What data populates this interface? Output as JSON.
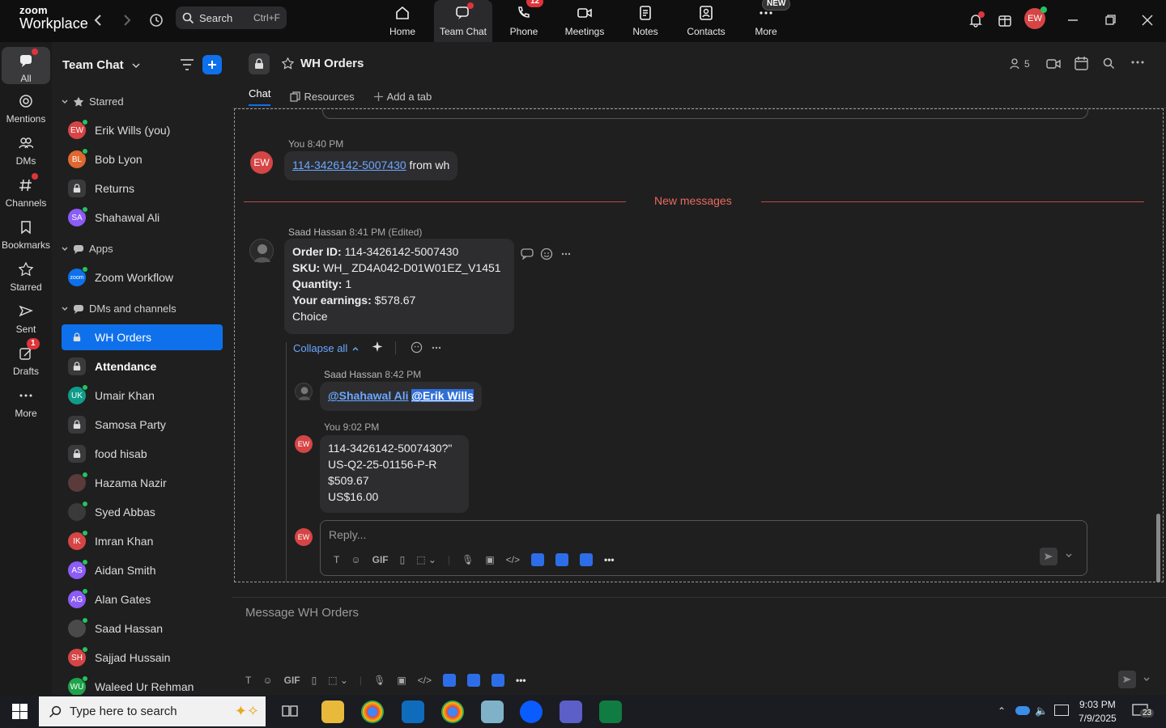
{
  "app": {
    "logo_line1": "zoom",
    "logo_line2": "Workplace"
  },
  "topbar": {
    "search_label": "Search",
    "search_shortcut": "Ctrl+F",
    "nav": [
      {
        "label": "Home"
      },
      {
        "label": "Team Chat"
      },
      {
        "label": "Phone",
        "badge": "12"
      },
      {
        "label": "Meetings"
      },
      {
        "label": "Notes"
      },
      {
        "label": "Contacts"
      },
      {
        "label": "More",
        "badge": "NEW"
      }
    ],
    "avatar_initials": "EW"
  },
  "rail": [
    {
      "label": "All"
    },
    {
      "label": "Mentions"
    },
    {
      "label": "DMs"
    },
    {
      "label": "Channels"
    },
    {
      "label": "Bookmarks"
    },
    {
      "label": "Starred"
    },
    {
      "label": "Sent"
    },
    {
      "label": "Drafts",
      "badge": "1"
    },
    {
      "label": "More"
    }
  ],
  "sidebar": {
    "title": "Team Chat",
    "sections": {
      "starred": "Starred",
      "apps": "Apps",
      "dms": "DMs and channels"
    },
    "starred": [
      {
        "initials": "EW",
        "name": "Erik Wills (you)",
        "color": "#d64545"
      },
      {
        "initials": "BL",
        "name": "Bob Lyon",
        "color": "#e0672f"
      },
      {
        "initials": "",
        "name": "Returns",
        "color": "lock"
      },
      {
        "initials": "SA",
        "name": "Shahawal Ali",
        "color": "#8b5cf6"
      }
    ],
    "apps": [
      {
        "initials": "zoom",
        "name": "Zoom Workflow",
        "color": "#0e71eb"
      }
    ],
    "dms": [
      {
        "initials": "",
        "name": "WH Orders",
        "color": "lock"
      },
      {
        "initials": "",
        "name": "Attendance",
        "color": "lock"
      },
      {
        "initials": "UK",
        "name": "Umair Khan",
        "color": "#0f9d8a"
      },
      {
        "initials": "",
        "name": "Samosa Party",
        "color": "lock"
      },
      {
        "initials": "",
        "name": "food hisab",
        "color": "lock"
      },
      {
        "initials": "",
        "name": "Hazama Nazir",
        "color": "#5a3a3a"
      },
      {
        "initials": "",
        "name": "Syed Abbas",
        "color": "#3a3a3a"
      },
      {
        "initials": "IK",
        "name": "Imran Khan",
        "color": "#d64545"
      },
      {
        "initials": "AS",
        "name": "Aidan Smith",
        "color": "#8b5cf6"
      },
      {
        "initials": "AG",
        "name": "Alan Gates",
        "color": "#8b5cf6"
      },
      {
        "initials": "",
        "name": "Saad Hassan",
        "color": "#4a4a4a"
      },
      {
        "initials": "SH",
        "name": "Sajjad Hussain",
        "color": "#d64545"
      },
      {
        "initials": "WU",
        "name": "Waleed Ur Rehman",
        "color": "#1fa34a"
      }
    ]
  },
  "channel": {
    "name": "WH Orders",
    "member_count": "5",
    "tabs": [
      "Chat",
      "Resources",
      "Add a tab"
    ]
  },
  "messages": {
    "m1": {
      "meta": "You 8:40 PM",
      "link": "114-3426142-5007430",
      "text": " from wh",
      "initials": "EW"
    },
    "divider": "New messages",
    "m2": {
      "sender": "Saad Hassan",
      "time": "8:41 PM (Edited)",
      "lines": [
        {
          "k": "Order ID:",
          "v": " 114-3426142-5007430"
        },
        {
          "k": "SKU:",
          "v": " WH_ ZD4A042-D01W01EZ_V1451"
        },
        {
          "k": "Quantity:",
          "v": " 1"
        },
        {
          "k": "Your earnings:",
          "v": " $578.67"
        },
        {
          "k": "",
          "v": "Choice"
        }
      ]
    },
    "collapse": "Collapse all",
    "r1": {
      "sender": "Saad Hassan",
      "time": "8:42 PM",
      "mention1": "@Shahawal Ali",
      "mention2": "@Erik Wills"
    },
    "r2": {
      "meta": "You 9:02 PM",
      "initials": "EW",
      "lines": [
        "114-3426142-5007430?\"",
        "US-Q2-25-01156-P-R",
        "$509.67",
        "US$16.00"
      ]
    },
    "reply_placeholder": "Reply...",
    "message_placeholder": "Message WH Orders"
  },
  "taskbar": {
    "search_placeholder": "Type here to search",
    "time": "9:03 PM",
    "date": "7/9/2025",
    "notif": "23"
  }
}
